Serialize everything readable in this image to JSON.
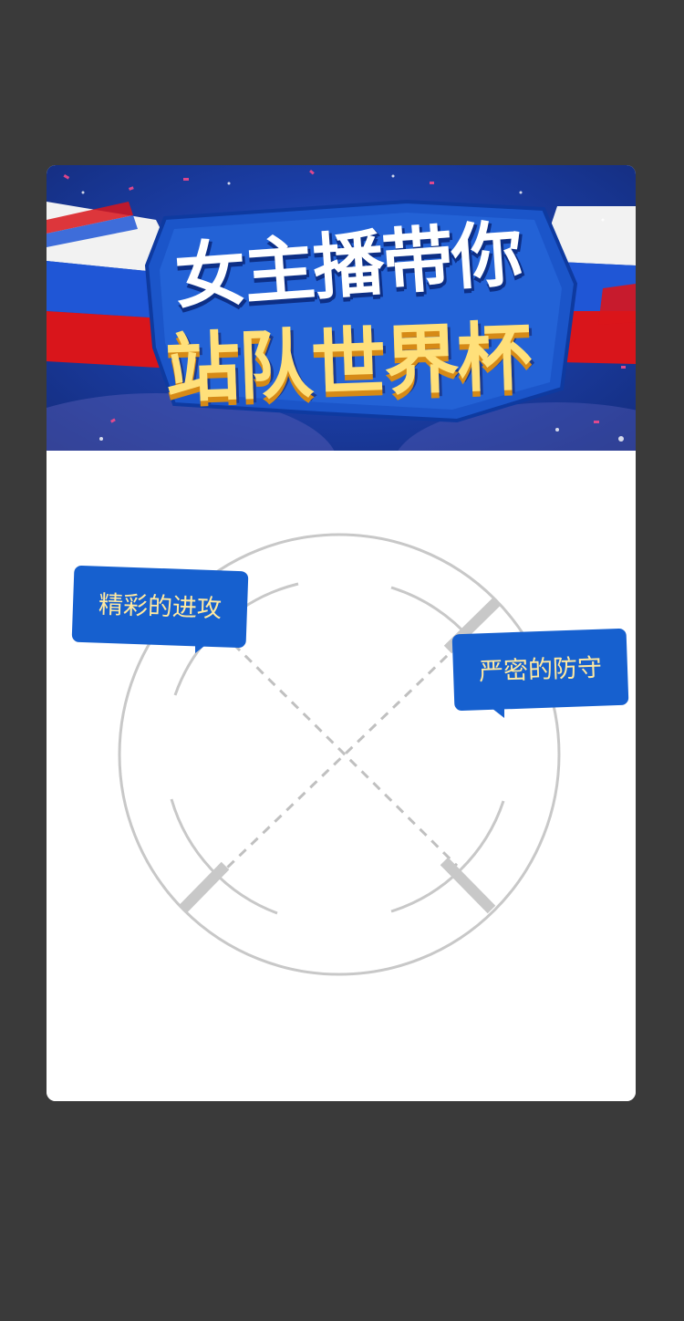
{
  "banner": {
    "title_line1": "女主播带你",
    "title_line2": "站队世界杯"
  },
  "options": {
    "attack": "精彩的进攻",
    "defense": "严密的防守"
  },
  "colors": {
    "page_background": "#3a3a3a",
    "modal_background": "#ffffff",
    "bubble_blue": "#1660cf",
    "bubble_text": "#ffe9a0",
    "title_white": "#ffffff",
    "title_yellow": "#ffe07a"
  },
  "icons": {
    "field_graphic": "circular-field-x-icon",
    "flag_left": "russia-flag-ribbon",
    "flag_right": "russia-flag-ribbon"
  }
}
